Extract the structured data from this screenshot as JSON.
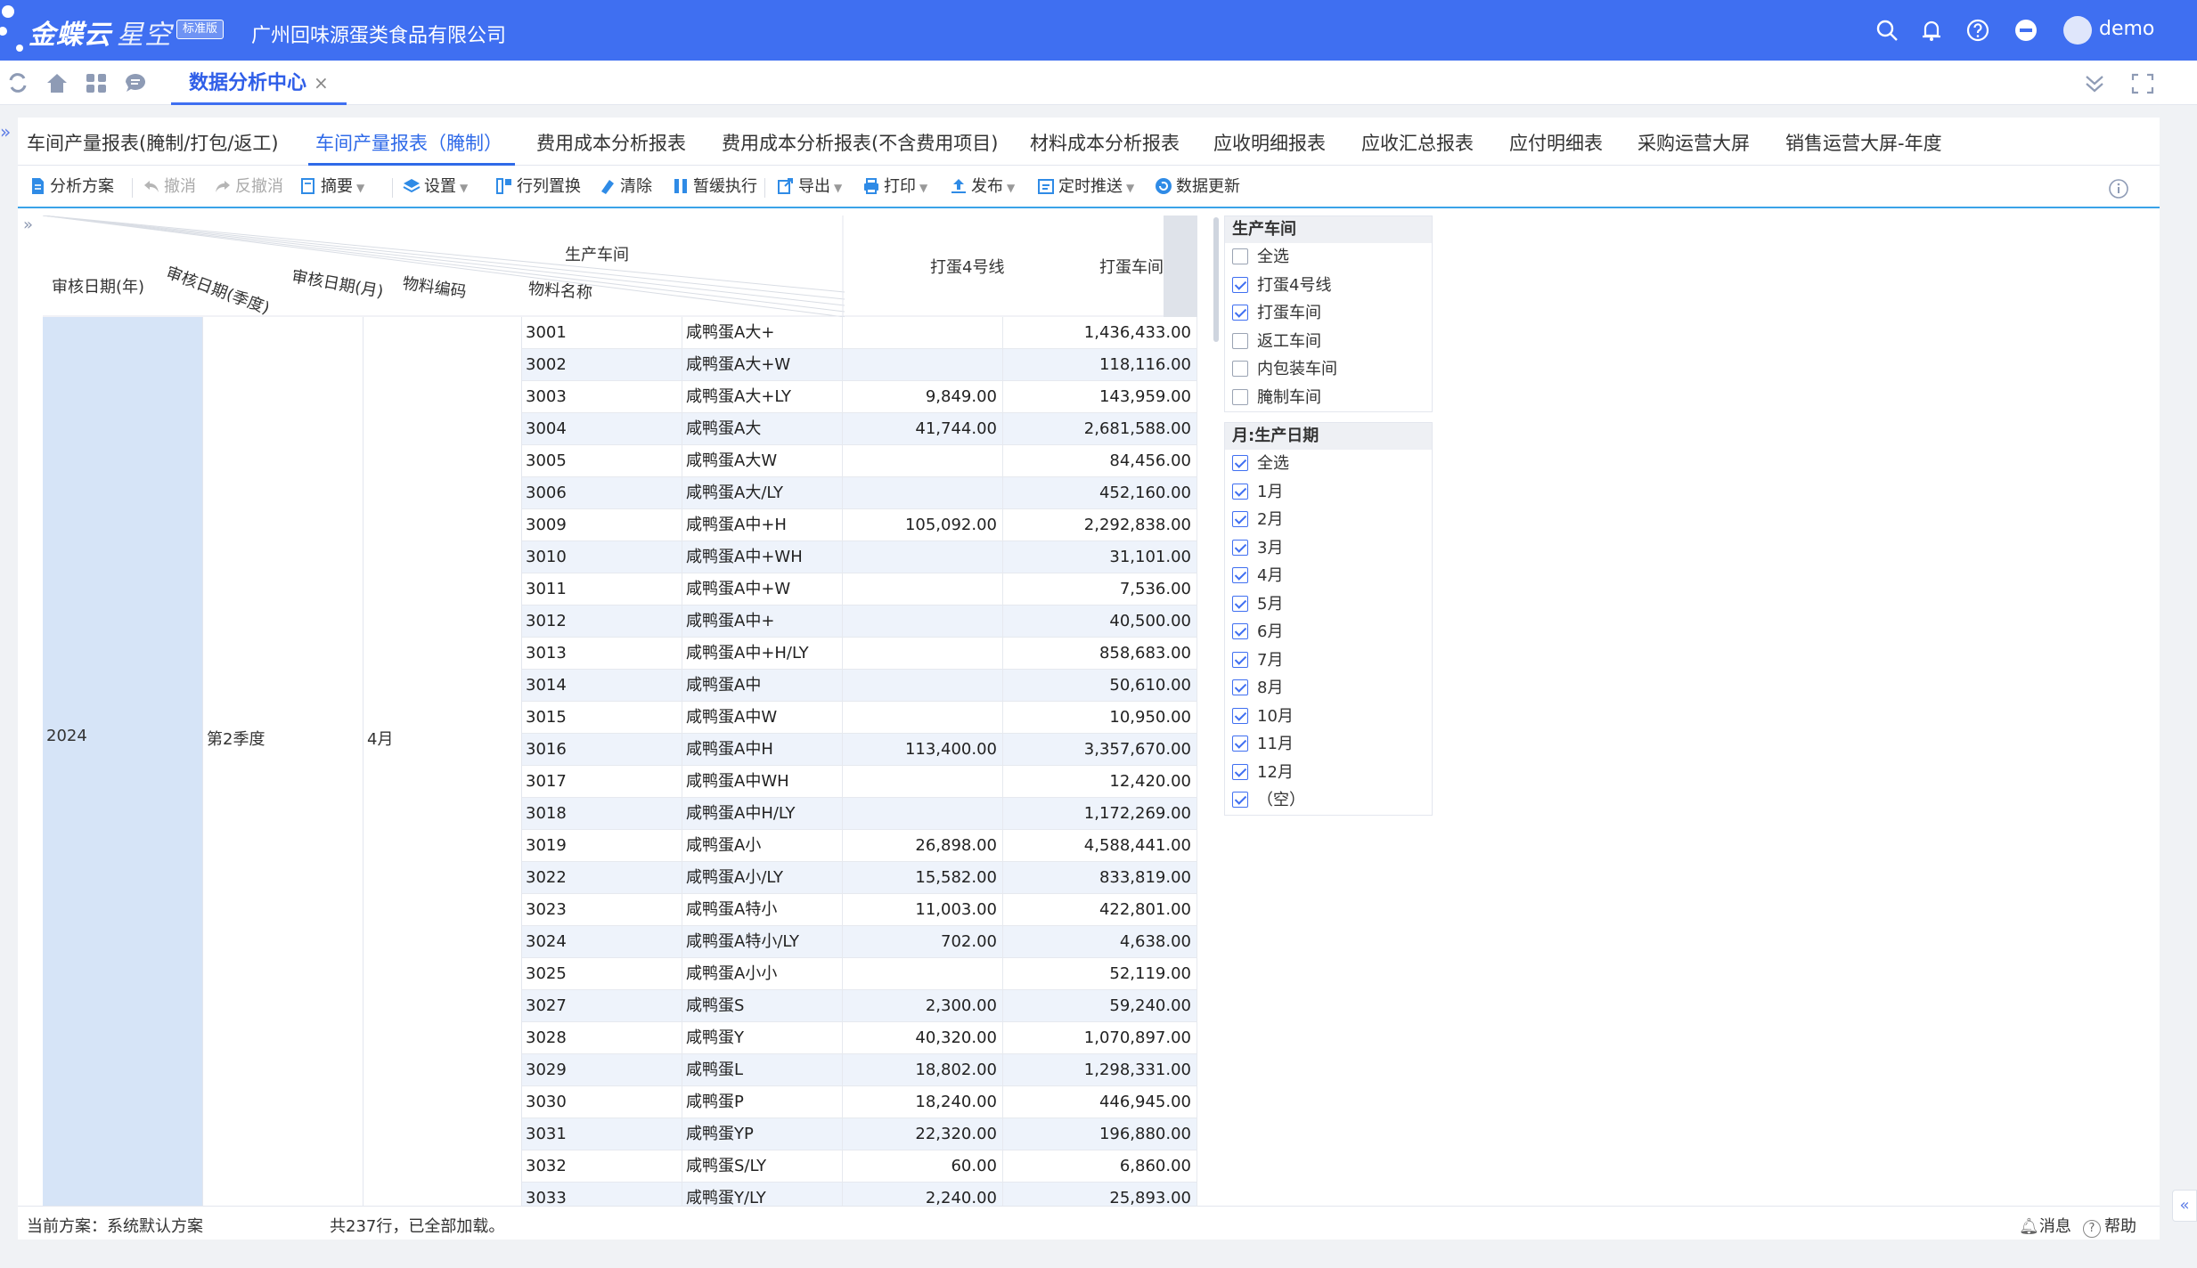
{
  "header": {
    "brand": "金蝶云",
    "brand_sub": "星空",
    "edition": "标准版",
    "company": "广州回味源蛋类食品有限公司",
    "user": "demo"
  },
  "header_icons": [
    "search-icon",
    "bell-icon",
    "help-icon",
    "minus-circle-icon"
  ],
  "nav": {
    "doc_tab": "数据分析中心",
    "close": "×"
  },
  "report_tabs": [
    "车间产量报表(腌制/打包/返工)",
    "车间产量报表（腌制）",
    "费用成本分析报表",
    "费用成本分析报表(不含费用项目)",
    "材料成本分析报表",
    "应收明细报表",
    "应收汇总报表",
    "应付明细表",
    "采购运营大屏",
    "销售运营大屏-年度"
  ],
  "active_tab": 1,
  "toolbar": {
    "scheme": "分析方案",
    "undo": "撤消",
    "redo": "反撤消",
    "summary": "摘要",
    "settings": "设置",
    "transpose": "行列置换",
    "clear": "清除",
    "pause": "暂缓执行",
    "export": "导出",
    "print": "打印",
    "publish": "发布",
    "schedule": "定时推送",
    "refresh": "数据更新"
  },
  "grid": {
    "col_dim": "生产车间",
    "row_dims": [
      "审核日期(年)",
      "审核日期(季度)",
      "审核日期(月)",
      "物料编码",
      "物料名称"
    ],
    "col_headers": [
      "打蛋4号线",
      "打蛋车间"
    ],
    "year": "2024",
    "quarter": "第2季度",
    "month": "4月",
    "rows": [
      [
        "3001",
        "咸鸭蛋A大+",
        "",
        "1,436,433.00"
      ],
      [
        "3002",
        "咸鸭蛋A大+W",
        "",
        "118,116.00"
      ],
      [
        "3003",
        "咸鸭蛋A大+LY",
        "9,849.00",
        "143,959.00"
      ],
      [
        "3004",
        "咸鸭蛋A大",
        "41,744.00",
        "2,681,588.00"
      ],
      [
        "3005",
        "咸鸭蛋A大W",
        "",
        "84,456.00"
      ],
      [
        "3006",
        "咸鸭蛋A大/LY",
        "",
        "452,160.00"
      ],
      [
        "3009",
        "咸鸭蛋A中+H",
        "105,092.00",
        "2,292,838.00"
      ],
      [
        "3010",
        "咸鸭蛋A中+WH",
        "",
        "31,101.00"
      ],
      [
        "3011",
        "咸鸭蛋A中+W",
        "",
        "7,536.00"
      ],
      [
        "3012",
        "咸鸭蛋A中+",
        "",
        "40,500.00"
      ],
      [
        "3013",
        "咸鸭蛋A中+H/LY",
        "",
        "858,683.00"
      ],
      [
        "3014",
        "咸鸭蛋A中",
        "",
        "50,610.00"
      ],
      [
        "3015",
        "咸鸭蛋A中W",
        "",
        "10,950.00"
      ],
      [
        "3016",
        "咸鸭蛋A中H",
        "113,400.00",
        "3,357,670.00"
      ],
      [
        "3017",
        "咸鸭蛋A中WH",
        "",
        "12,420.00"
      ],
      [
        "3018",
        "咸鸭蛋A中H/LY",
        "",
        "1,172,269.00"
      ],
      [
        "3019",
        "咸鸭蛋A小",
        "26,898.00",
        "4,588,441.00"
      ],
      [
        "3022",
        "咸鸭蛋A小/LY",
        "15,582.00",
        "833,819.00"
      ],
      [
        "3023",
        "咸鸭蛋A特小",
        "11,003.00",
        "422,801.00"
      ],
      [
        "3024",
        "咸鸭蛋A特小/LY",
        "702.00",
        "4,638.00"
      ],
      [
        "3025",
        "咸鸭蛋A小小",
        "",
        "52,119.00"
      ],
      [
        "3027",
        "咸鸭蛋S",
        "2,300.00",
        "59,240.00"
      ],
      [
        "3028",
        "咸鸭蛋Y",
        "40,320.00",
        "1,070,897.00"
      ],
      [
        "3029",
        "咸鸭蛋L",
        "18,802.00",
        "1,298,331.00"
      ],
      [
        "3030",
        "咸鸭蛋P",
        "18,240.00",
        "446,945.00"
      ],
      [
        "3031",
        "咸鸭蛋YP",
        "22,320.00",
        "196,880.00"
      ],
      [
        "3032",
        "咸鸭蛋S/LY",
        "60.00",
        "6,860.00"
      ],
      [
        "3033",
        "咸鸭蛋Y/LY",
        "2,240.00",
        "25,893.00"
      ]
    ]
  },
  "filters": {
    "workshop": {
      "title": "生产车间",
      "items": [
        {
          "label": "全选",
          "checked": false
        },
        {
          "label": "打蛋4号线",
          "checked": true
        },
        {
          "label": "打蛋车间",
          "checked": true
        },
        {
          "label": "返工车间",
          "checked": false
        },
        {
          "label": "内包装车间",
          "checked": false
        },
        {
          "label": "腌制车间",
          "checked": false
        }
      ]
    },
    "month": {
      "title": "月:生产日期",
      "items": [
        {
          "label": "全选",
          "checked": true
        },
        {
          "label": "1月",
          "checked": true
        },
        {
          "label": "2月",
          "checked": true
        },
        {
          "label": "3月",
          "checked": true
        },
        {
          "label": "4月",
          "checked": true
        },
        {
          "label": "5月",
          "checked": true
        },
        {
          "label": "6月",
          "checked": true
        },
        {
          "label": "7月",
          "checked": true
        },
        {
          "label": "8月",
          "checked": true
        },
        {
          "label": "10月",
          "checked": true
        },
        {
          "label": "11月",
          "checked": true
        },
        {
          "label": "12月",
          "checked": true
        },
        {
          "label": "（空）",
          "checked": true
        }
      ]
    }
  },
  "status": {
    "scheme": "当前方案：系统默认方案",
    "rows": "共237行，已全部加载。",
    "message": "消息",
    "help": "帮助"
  },
  "colors": {
    "brand": "#3f6ff1",
    "accent": "#2f6ae8",
    "row_alt": "#eef3fb",
    "dim_fill": "#d6e4f7"
  }
}
